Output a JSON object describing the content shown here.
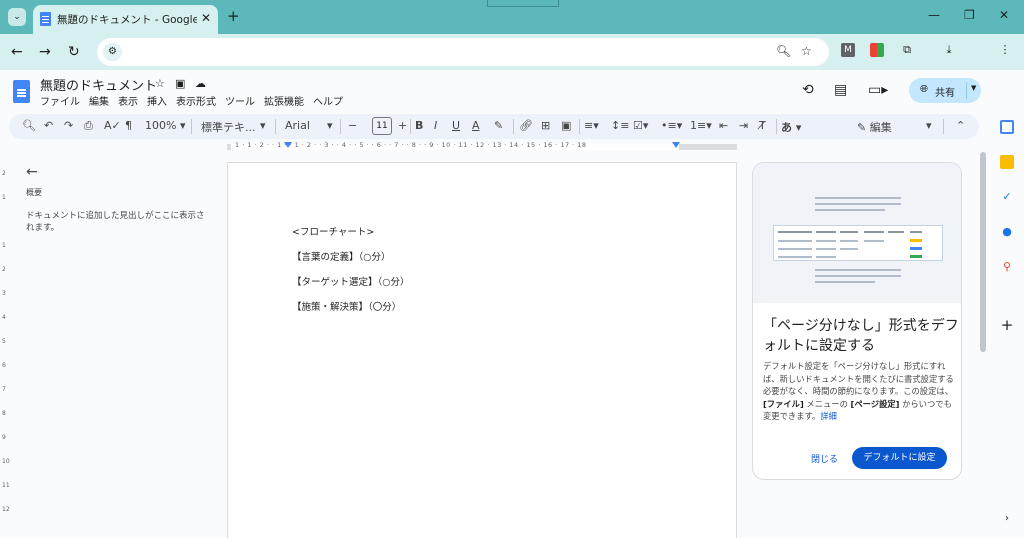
{
  "browser": {
    "tab_title": "無題のドキュメント - Google ドキュメント",
    "tab_close": "✕",
    "new_tab": "+",
    "window_controls": [
      "—",
      "❐",
      "✕"
    ],
    "nav": [
      "←",
      "→",
      "↻"
    ]
  },
  "doc": {
    "title": "無題のドキュメント",
    "menu": [
      "ファイル",
      "編集",
      "表示",
      "挿入",
      "表示形式",
      "ツール",
      "拡張機能",
      "ヘルプ"
    ],
    "share_label": "共有"
  },
  "format_toolbar": {
    "zoom": "100%",
    "style": "標準テキ...",
    "font": "Arial",
    "font_size": "11",
    "mode": "編集",
    "input_mode": "あ"
  },
  "ruler": {
    "numbers": "1 · 1 · 2 · · 1 · · 1 · 2 · · 3 · · 4 · · 5 · · 6 · · 7 · · 8 · · 9 · 10 · 11 · 12 · 13 · 14 · 15 · 16 · 17 · 18",
    "vertical": [
      "2",
      "1",
      "1",
      "2",
      "3",
      "4",
      "5",
      "6",
      "7",
      "8",
      "9",
      "10",
      "11",
      "12"
    ]
  },
  "outline": {
    "title": "概要",
    "hint": "ドキュメントに追加した見出しがここに表示されます。"
  },
  "page": {
    "lines": [
      "<フローチャート>",
      "【言葉の定義】（○分）",
      "【ターゲット選定】（○分）",
      "【施策・解決策】（〇分）"
    ]
  },
  "promo": {
    "title": "「ページ分けなし」形式をデフォルトに設定する",
    "body_1": "デフォルト設定を「ページ分けなし」形式にすれば、新しいドキュメントを開くたびに書式設定する必要がなく、時間の節約になります。この設定は、",
    "body_bold_1": "[ファイル]",
    "body_2": " メニューの ",
    "body_bold_2": "[ページ設定]",
    "body_3": " からいつでも変更できます。",
    "link": "詳細",
    "close_label": "閉じる",
    "default_label": "デフォルトに設定"
  },
  "colors": {
    "tabstrip": "#5cb8b9",
    "toolbar": "#d6efef",
    "accent": "#0b57d0",
    "share_bg": "#c2e7ff"
  }
}
